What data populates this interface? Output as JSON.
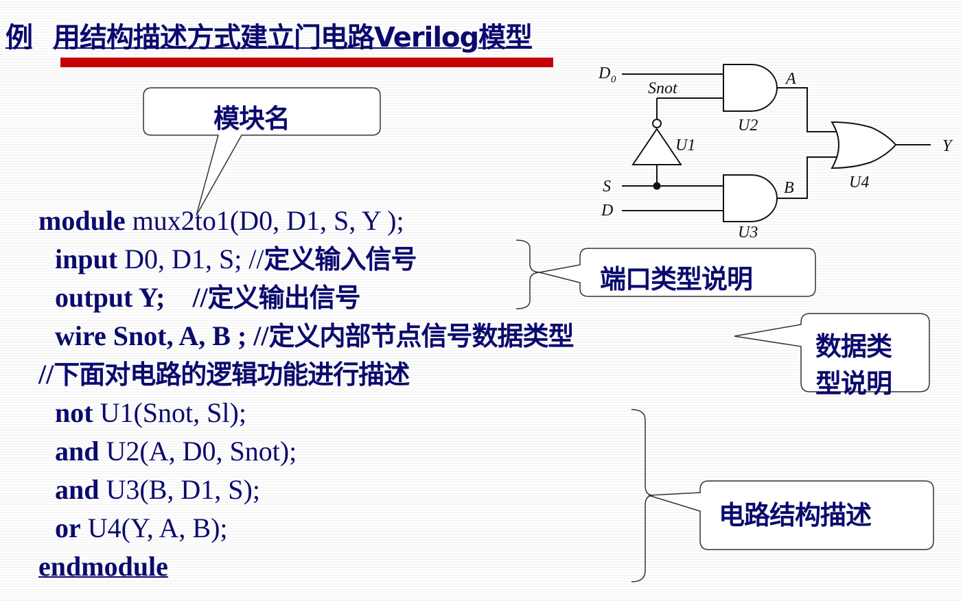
{
  "title": {
    "prefix": "例",
    "text": "用结构描述方式建立门电路Verilog模型"
  },
  "code": {
    "module_kw": "module",
    "module_rest": " mux2to1(D0, D1, S, Y );",
    "input_kw": "input",
    "input_rest": " D0, D1, S;  //",
    "input_comment": "定义输入信号",
    "output_kw": "output Y;",
    "output_rest": "    //",
    "output_comment": "定义输出信号",
    "wire_kw": "wire Snot, A, B ; //",
    "wire_comment": "定义内部节点信号数据类型",
    "comment_prefix": "//",
    "comment_line": "下面对电路的逻辑功能进行描述",
    "not_kw": "not",
    "not_rest": " U1(Snot, Sl);",
    "and1_kw": "and",
    "and1_rest": " U2(A, D0, Snot);",
    "and2_kw": "and",
    "and2_rest": " U3(B, D1, S);",
    "or_kw": "or",
    "or_rest": " U4(Y, A, B);",
    "end_kw": "endmodule"
  },
  "callouts": {
    "module_name": "模块名",
    "port_type": "端口类型说明",
    "data_type_line1": "数据类",
    "data_type_line2": "型说明",
    "structure": "电路结构描述"
  },
  "circuit": {
    "d0_label": "D",
    "d0_sub": "0",
    "snot_label": "Snot",
    "a_label": "A",
    "u1_label": "U1",
    "u2_label": "U2",
    "u3_label": "U3",
    "u4_label": "U4",
    "s_label": "S",
    "d_label": "D",
    "b_label": "B",
    "y_label": "Y"
  },
  "colors": {
    "text": "#0a0a6e",
    "accent_bar": "#c40000"
  }
}
